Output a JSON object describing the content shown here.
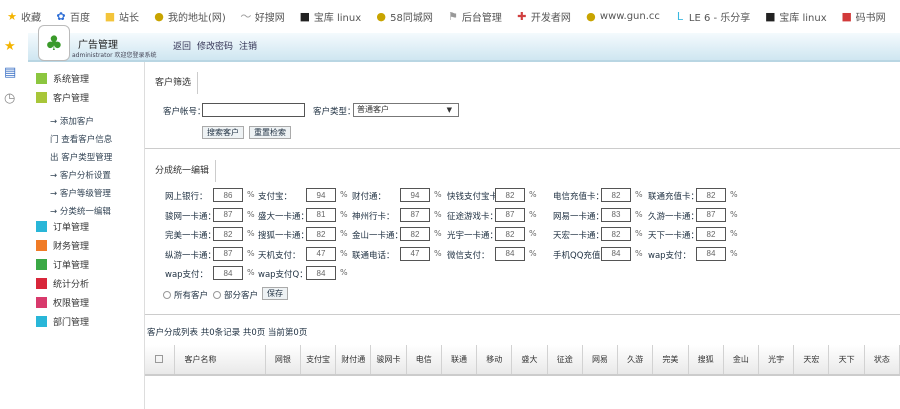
{
  "bookmarks": [
    {
      "label": "收藏",
      "icon": "star-icon",
      "color": "#f4b400"
    },
    {
      "label": "百度",
      "icon": "paw-icon",
      "color": "#2f6fd6"
    },
    {
      "label": "站长",
      "icon": "folder-icon",
      "color": "#f3c43a"
    },
    {
      "label": "我的地址(网)",
      "icon": "circle-icon",
      "color": "#c8a400"
    },
    {
      "label": "好搜网",
      "icon": "swoosh-icon",
      "color": "#999999"
    },
    {
      "label": "宝库 linux",
      "icon": "square-icon",
      "color": "#222222"
    },
    {
      "label": "58同城网",
      "icon": "circle-icon",
      "color": "#c8a400"
    },
    {
      "label": "后台管理",
      "icon": "flag-icon",
      "color": "#999999"
    },
    {
      "label": "开发者网",
      "icon": "cross-icon",
      "color": "#d04040"
    },
    {
      "label": "www.gun.cc",
      "icon": "circle-icon",
      "color": "#c8a400"
    },
    {
      "label": "LE 6 - 乐分享",
      "icon": "le-icon",
      "color": "#39b8e0"
    },
    {
      "label": "宝库 linux",
      "icon": "square-icon",
      "color": "#222222"
    },
    {
      "label": "码书网",
      "icon": "book-icon",
      "color": "#d23a3a"
    }
  ],
  "header": {
    "system_name": "广告管理",
    "user_info": "administrator 欢迎您登录系统",
    "links": [
      "返回",
      "修改密码",
      "注销"
    ]
  },
  "sidebar": {
    "items": [
      {
        "label": "系统管理",
        "color": "#8cc63f"
      },
      {
        "label": "客户管理",
        "color": "#a8c639"
      }
    ],
    "sub_items": [
      "→ 添加客户",
      "门 查看客户信息",
      "出 客户类型管理",
      "→ 客户分析设置",
      "→ 客户等级管理",
      "→ 分类统一编辑"
    ],
    "items2": [
      {
        "label": "订单管理",
        "color": "#29b6d8"
      },
      {
        "label": "财务管理",
        "color": "#f07b26"
      },
      {
        "label": "订单管理",
        "color": "#3aa845"
      },
      {
        "label": "统计分析",
        "color": "#d8263a"
      },
      {
        "label": "权限管理",
        "color": "#d83a6c"
      },
      {
        "label": "部门管理",
        "color": "#29b6d8"
      }
    ]
  },
  "filter": {
    "tab": "客户筛选",
    "account_label": "客户帐号：",
    "account_value": "",
    "type_label": "客户类型：",
    "type_value": "普通客户",
    "btn_search": "搜索客户",
    "btn_reset": "重置检索"
  },
  "rates": {
    "tab": "分成统一编辑",
    "pct": "%",
    "fields": [
      {
        "label": "网上银行：",
        "value": "86"
      },
      {
        "label": "支付宝：",
        "value": "94"
      },
      {
        "label": "财付通：",
        "value": "94"
      },
      {
        "label": "快钱支付宝卡：",
        "value": "82"
      },
      {
        "label": "电信充值卡：",
        "value": "82"
      },
      {
        "label": "联通充值卡：",
        "value": "82"
      },
      {
        "label": "骏网一卡通：",
        "value": "87"
      },
      {
        "label": "盛大一卡通：",
        "value": "81"
      },
      {
        "label": "神州行卡：",
        "value": "87"
      },
      {
        "label": "征途游戏卡：",
        "value": "87"
      },
      {
        "label": "网易一卡通：",
        "value": "83"
      },
      {
        "label": "久游一卡通：",
        "value": "87"
      },
      {
        "label": "完美一卡通：",
        "value": "82"
      },
      {
        "label": "搜狐一卡通：",
        "value": "82"
      },
      {
        "label": "金山一卡通：",
        "value": "82"
      },
      {
        "label": "光宇一卡通：",
        "value": "82"
      },
      {
        "label": "天宏一卡通：",
        "value": "82"
      },
      {
        "label": "天下一卡通：",
        "value": "82"
      },
      {
        "label": "纵游一卡通：",
        "value": "87"
      },
      {
        "label": "天机支付：",
        "value": "47"
      },
      {
        "label": "联通电话：",
        "value": "47"
      },
      {
        "label": "微信支付：",
        "value": "84"
      },
      {
        "label": "手机QQ充值：",
        "value": "84"
      },
      {
        "label": "wap支付：",
        "value": "84"
      },
      {
        "label": "wap支付：",
        "value": "84"
      },
      {
        "label": "wap支付Q：",
        "value": "84"
      }
    ],
    "radio_all": "所有客户",
    "radio_selected": "部分客户",
    "btn_save": "保存"
  },
  "list": {
    "caption": "客户分成列表 共0条记录 共0页 当前第0页",
    "columns": [
      "客户名称",
      "网银",
      "支付宝",
      "财付通",
      "骏网卡",
      "电信",
      "联通",
      "移动",
      "盛大",
      "征途",
      "网易",
      "久游",
      "完美",
      "搜狐",
      "金山",
      "光宇",
      "天宏",
      "天下",
      "状态"
    ]
  }
}
